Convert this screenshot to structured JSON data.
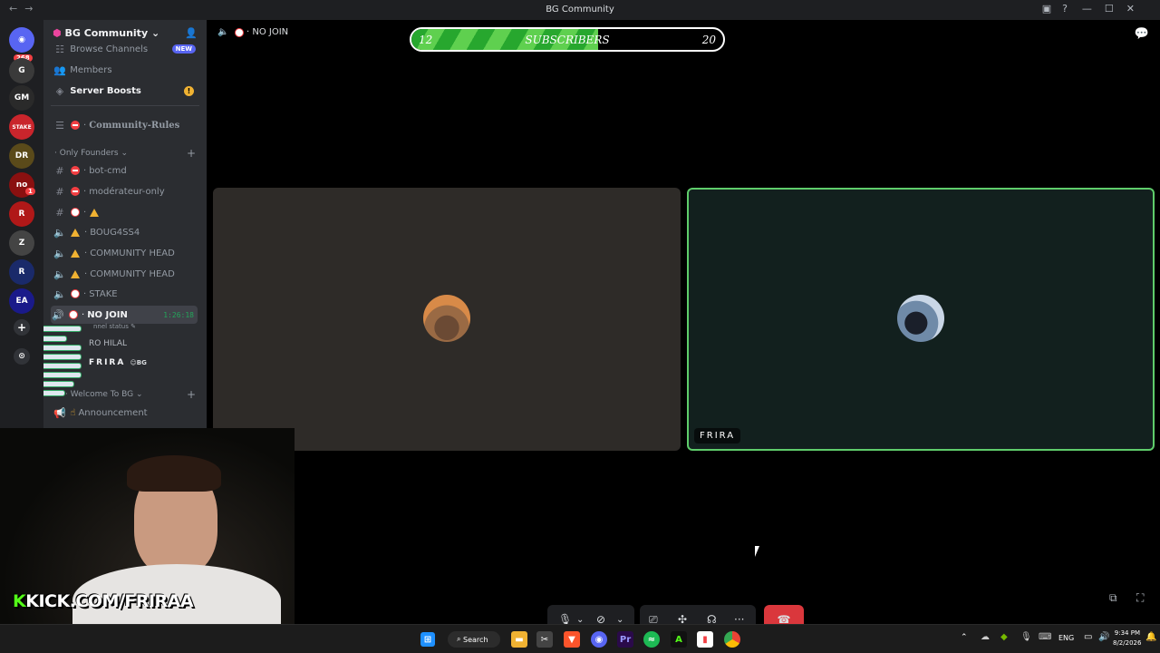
{
  "window": {
    "title": "BG Community",
    "nav_back": "←",
    "nav_forward": "→",
    "minimize": "—",
    "maximize": "☐",
    "close": "✕"
  },
  "rail": {
    "home_badge": "268",
    "servers": [
      {
        "label": "G",
        "color": "#3a3a3a"
      },
      {
        "label": "GM",
        "color": "#2a2a2a"
      },
      {
        "label": "STAKE",
        "color": "#c9252c"
      },
      {
        "label": "DR",
        "color": "#5a4a1a"
      },
      {
        "label": "no",
        "color": "#8a1010"
      },
      {
        "label": "R",
        "color": "#b01818"
      },
      {
        "label": "Z",
        "color": "#444"
      },
      {
        "label": "R",
        "color": "#1a2a6a"
      },
      {
        "label": "EA",
        "color": "#1a1a8a"
      }
    ],
    "server_badge_1": "1",
    "add_server": "+",
    "discover": "⊙"
  },
  "sidebar": {
    "server_name": "BG Community",
    "browse_channels": "Browse Channels",
    "new_badge": "NEW",
    "members": "Members",
    "server_boosts": "Server Boosts",
    "boost_alert": "!",
    "community_rules": "Community-Rules",
    "category_founders": "Only Founders",
    "channels": [
      {
        "name": "bot-cmd",
        "type": "text",
        "status": "red"
      },
      {
        "name": "modérateur-only",
        "type": "text",
        "status": "red"
      },
      {
        "name": "",
        "type": "text",
        "status": "ban",
        "warn": true
      },
      {
        "name": "BOUG4SS4",
        "type": "voice",
        "status": "warn"
      },
      {
        "name": "COMMUNITY HEAD",
        "type": "voice",
        "status": "warn"
      },
      {
        "name": "COMMUNITY HEAD",
        "type": "voice",
        "status": "warn"
      },
      {
        "name": "STAKE",
        "type": "voice",
        "status": "ban"
      }
    ],
    "active_channel": "NO JOIN",
    "active_timer": "1:26:18",
    "channel_status_hint": "nnel status",
    "member_1": "RO HILAL",
    "member_2": "FRIRA",
    "member_2_tag": "BG",
    "category_welcome": "Welcome To BG",
    "announcement": "Announcement"
  },
  "call": {
    "channel_label": "NO JOIN",
    "participant_name": "FRIRA",
    "colors": {
      "left_tile": "#2e2b28",
      "right_tile": "#12201e",
      "speaking_border": "#5fcd6b"
    }
  },
  "overlay": {
    "progress_start": "12",
    "progress_label": "SUBSCRIBERS",
    "progress_end": "20",
    "progress_fraction": 0.6,
    "kick_prefix": "K",
    "kick_text": "KICK.COM/FRIRAA"
  },
  "controls": {
    "mic_icon": "🎙",
    "camera_icon": "⊘",
    "screen_icon": "⎚",
    "activities_icon": "✣",
    "soundboard_icon": "☊",
    "more_icon": "···",
    "hangup_icon": "☎",
    "caret": "⌄"
  },
  "taskbar": {
    "search_label": "Search",
    "lang": "ENG",
    "time": "9:34 PM",
    "date": "8/2/2026"
  }
}
